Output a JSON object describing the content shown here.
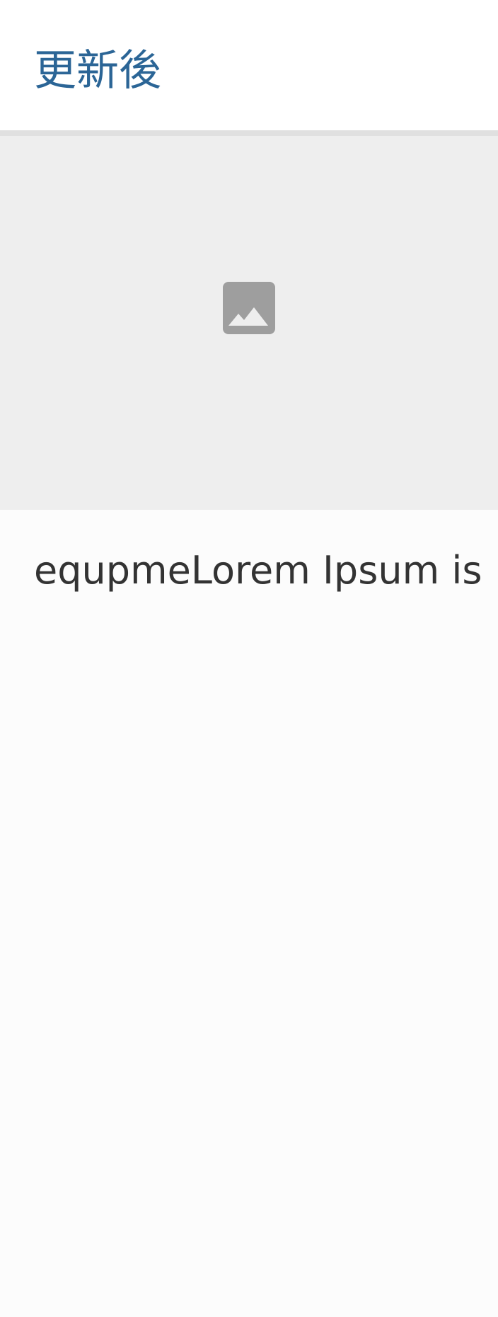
{
  "header": {
    "title": "更新後",
    "title_color": "#2b6596"
  },
  "hero_image": {
    "icon": "image-placeholder-icon",
    "background_color": "#eeeeee",
    "icon_color": "#9e9e9e"
  },
  "content": {
    "text": "equpmeLorem Ipsum is"
  }
}
